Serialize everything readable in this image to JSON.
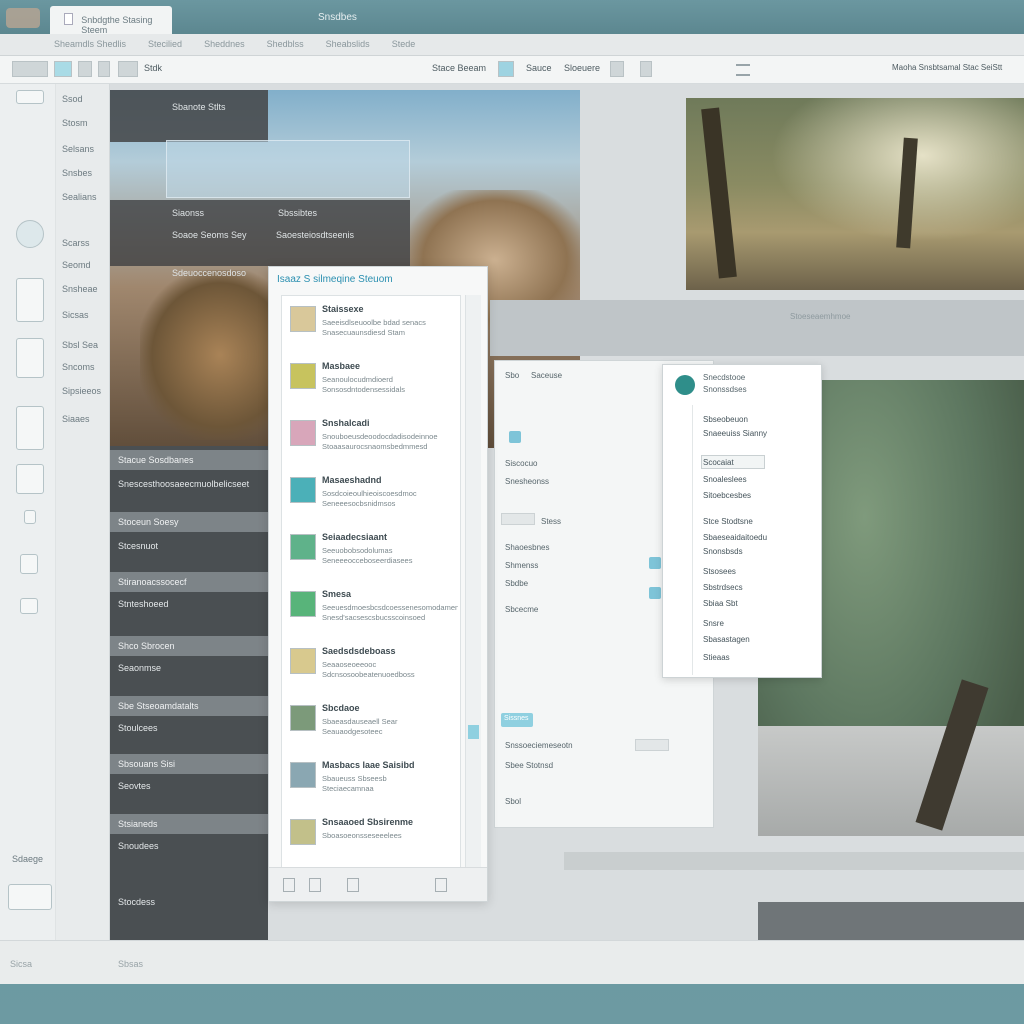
{
  "titlebar": {
    "tab_label": "Snbdgthe Stasing Steem",
    "window_title": "Snsdbes"
  },
  "menubar": {
    "items": [
      "Sheamdls Shedlis",
      "Stecilied",
      "Sheddnes",
      "Shedblss",
      "Sheabslids",
      "Stede"
    ]
  },
  "toolbar": {
    "left_label": "Stdk",
    "center_items": [
      "Stace Beeam",
      "Sauce",
      "Sloeuere"
    ],
    "right_label": "Maoha Snsbtsamal Stac SeiStt"
  },
  "leftpane": {
    "labels": [
      "Ssod",
      "Stosm",
      "Selsans",
      "Snsbes",
      "Sealians",
      "Scarss",
      "Seomd",
      "Snsheae",
      "Sicsas",
      "Sbsl Sea",
      "Sncoms",
      "Sipsieeos",
      "Siaaes"
    ],
    "bottom_label": "Sdaege"
  },
  "left_strip": {
    "rows": [
      "Stacue Sosdbanes",
      "Snescesthoosaeecmuolbelicseet",
      "Stoceun Soesy",
      "Stcesnuot",
      "Stiranoacssocecf",
      "Stnteshoeed",
      "Shco Sbrocen",
      "Seaonmse",
      "Sbe Stseoamdatalts",
      "Stoulcees",
      "Sbsouans Sisi",
      "Seovtes",
      "Stsianeds",
      "Snoudees",
      "Stocdess"
    ]
  },
  "photo_panel": {
    "top_title": "Sbanote Stlts",
    "row1_left": "Siaonss",
    "row1_right": "Sbssibtes",
    "row2_left": "Soaoe Seoms Sey",
    "row2_right": "Saoesteiosdtseenis",
    "row3": "Sdeuoccenosdoso"
  },
  "dialog": {
    "title": "Isaaz S silmeqine Steuom",
    "items": [
      {
        "name": "Staissexe",
        "d1": "Saeeisdlseuoolbe bdad senacs",
        "d2": "Snasecuaunsdiesd Stam",
        "color": "#d9c89a"
      },
      {
        "name": "Masbaee",
        "d1": "Seanoulocudmdioerd",
        "d2": "Sonsosdntodensessidals",
        "color": "#c7c35e"
      },
      {
        "name": "Snshalcadi",
        "d1": "Snouboeusdeoodocdadisodeinnoe",
        "d2": "Stoaasaurocsnaomsbedmmesd",
        "color": "#d8a6ba"
      },
      {
        "name": "Masaeshadnd",
        "d1": "Sosdcoieoulhieoiscoesdmoc",
        "d2": "Seneeesocbsnidmsos",
        "color": "#4bb0b8"
      },
      {
        "name": "Seiaadecsiaant",
        "d1": "Seeuobobsodolumas",
        "d2": "Seneeeocceboseerdiasees",
        "color": "#5fb28a"
      },
      {
        "name": "Smesa",
        "d1": "Seeuesdmoesbcsdcoessenesomodamens",
        "d2": "Snesd'sacsescsbucsscoinsoed",
        "color": "#58b47a"
      },
      {
        "name": "Saedsdsdeboass",
        "d1": "Seaaoseoeeooc",
        "d2": "Sdcnsosoobeatenuoedboss",
        "color": "#d8c98e"
      },
      {
        "name": "Sbcdaoe",
        "d1": "Sbaeasdauseaell Sear",
        "d2": "Seauaodgesoteec",
        "color": "#7c9a7a"
      },
      {
        "name": "Masbacs laae Saisibd",
        "d1": "Sbaueuss Sbseesb",
        "d2": "Steciaecamnaa",
        "color": "#8aa7b2"
      },
      {
        "name": "Snsaaoed Sbsirenme",
        "d1": "Sboasoeonsseseeelees",
        "d2": "",
        "color": "#c2c08a"
      }
    ]
  },
  "settings": {
    "rows": [
      "Sbo",
      "Saceuse",
      "Siscocuo",
      "Snesheonss",
      "Stess",
      "Shaoesbnes",
      "Shmenss",
      "Sbdbe",
      "Sbcecme"
    ],
    "foot_row1": "Snssoeciemeseotn",
    "foot_row2": "Sbee Stotnsd",
    "foot_row3": "Sbol",
    "button_label": "Sissnes"
  },
  "popover": {
    "head1": "Snecdstooe",
    "head2": "Snonssdses",
    "items": [
      "Sbseobeuon",
      "Snaeeuiss Sianny",
      "Scocaiat",
      "Snoaleslees",
      "Sitoebcesbes",
      "Stce Stodtsne",
      "Sbaeseaidaitoedu",
      "Snonsbsds",
      "Stsosees",
      "Sbstrdsecs",
      "Sbiaa Sbt",
      "Snsre",
      "Sbasastagen",
      "Stieaas"
    ]
  },
  "statusbar": {
    "left": "Sicsa",
    "right": "Sbsas"
  },
  "grey_band_text": "Stoeseaemhmoe"
}
